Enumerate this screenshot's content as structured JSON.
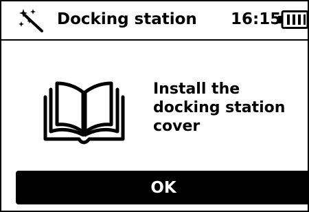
{
  "header": {
    "title": "Docking station",
    "time": "16:15",
    "mode_icon": "magic-wand-icon",
    "battery_icon": "battery-icon",
    "battery_level": 0.75
  },
  "main": {
    "illustration_icon": "open-book-icon",
    "message_lines": [
      "Install the",
      "docking station",
      "cover"
    ]
  },
  "actions": {
    "ok_label": "OK"
  }
}
